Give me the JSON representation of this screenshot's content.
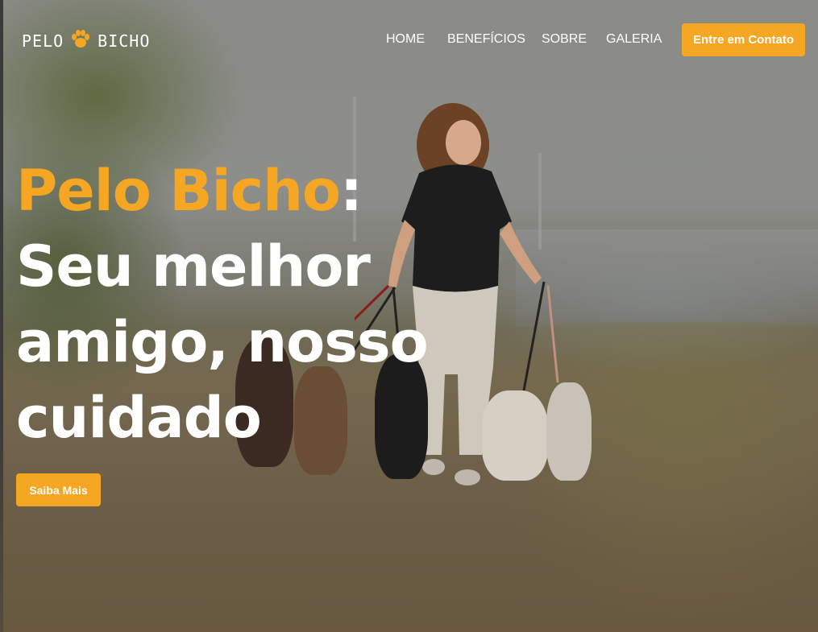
{
  "brand": {
    "logo_left": "PELO",
    "logo_right": "BICHO",
    "paw_icon": "paw-icon",
    "accent_color": "#f5a623"
  },
  "nav": {
    "items": [
      {
        "label": "HOME"
      },
      {
        "label": "BENEFÍCIOS"
      },
      {
        "label": "SOBRE"
      },
      {
        "label": "GALERIA"
      }
    ],
    "cta_label": "Entre em Contato"
  },
  "hero": {
    "brand_name": "Pelo Bicho",
    "brand_suffix": ":",
    "headline_lines": [
      "Seu melhor",
      "amigo, nosso",
      "cuidado"
    ],
    "cta_label": "Saiba Mais"
  }
}
